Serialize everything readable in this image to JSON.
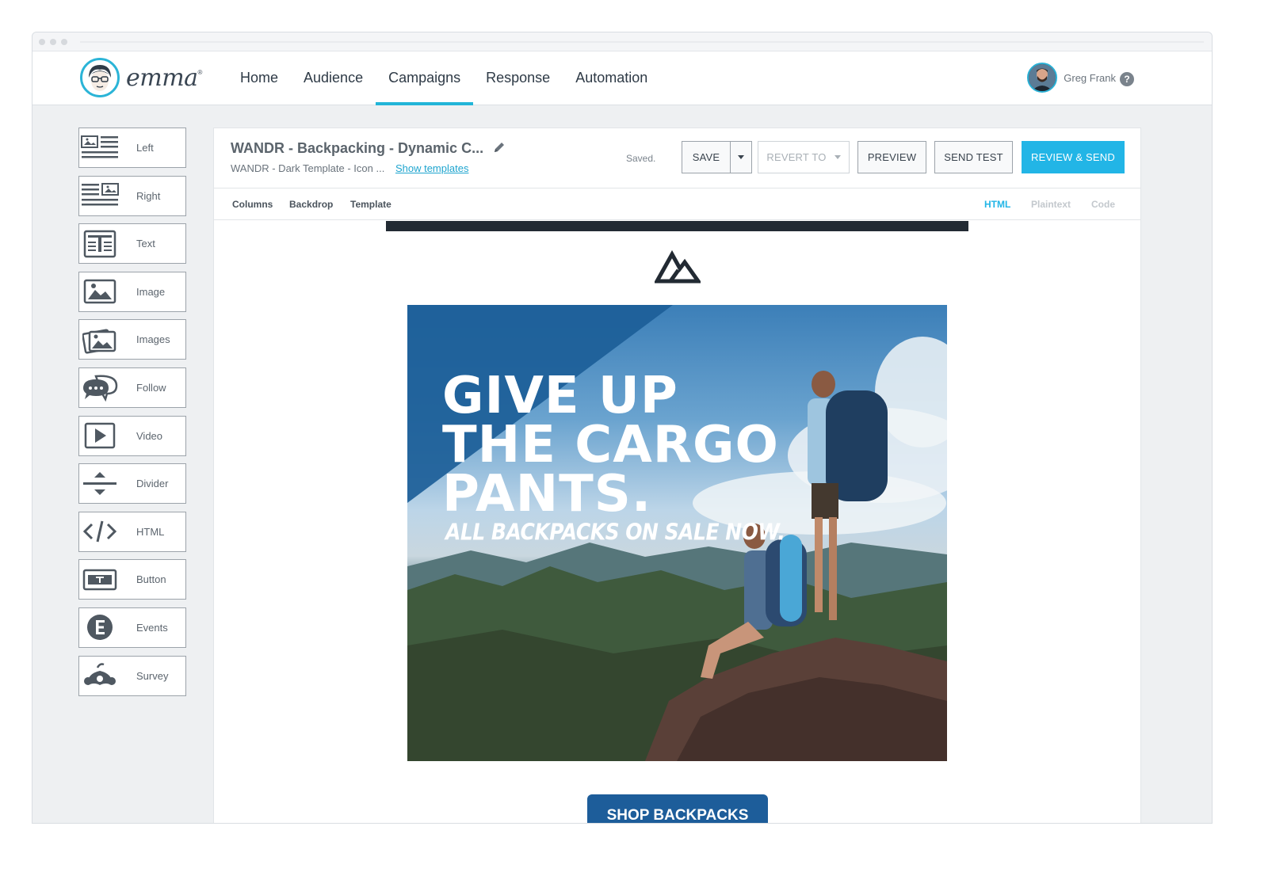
{
  "nav": {
    "brand": "emma",
    "brand_mark": "®",
    "items": [
      {
        "label": "Home",
        "active": false
      },
      {
        "label": "Audience",
        "active": false
      },
      {
        "label": "Campaigns",
        "active": true
      },
      {
        "label": "Response",
        "active": false
      },
      {
        "label": "Automation",
        "active": false
      }
    ],
    "user_name": "Greg Frank",
    "help_icon": "?"
  },
  "palette": {
    "blocks": [
      {
        "label": "Left",
        "icon": "layout-left-icon"
      },
      {
        "label": "Right",
        "icon": "layout-right-icon"
      },
      {
        "label": "Text",
        "icon": "text-block-icon"
      },
      {
        "label": "Image",
        "icon": "image-icon"
      },
      {
        "label": "Images",
        "icon": "images-icon"
      },
      {
        "label": "Follow",
        "icon": "chat-bubbles-icon"
      },
      {
        "label": "Video",
        "icon": "play-icon"
      },
      {
        "label": "Divider",
        "icon": "divider-icon"
      },
      {
        "label": "HTML",
        "icon": "code-icon"
      },
      {
        "label": "Button",
        "icon": "button-icon"
      },
      {
        "label": "Events",
        "icon": "events-icon"
      },
      {
        "label": "Survey",
        "icon": "survey-icon"
      }
    ]
  },
  "editor": {
    "title": "WANDR - Backpacking - Dynamic C...",
    "subtitle": "WANDR - Dark Template - Icon ...",
    "show_templates": "Show templates",
    "status": "Saved.",
    "buttons": {
      "save": "SAVE",
      "revert": "REVERT TO",
      "preview": "PREVIEW",
      "send_test": "SEND TEST",
      "review_send": "REVIEW & SEND"
    },
    "tabs_left": [
      "Columns",
      "Backdrop",
      "Template"
    ],
    "tabs_right": [
      {
        "label": "HTML",
        "active": true
      },
      {
        "label": "Plaintext",
        "active": false
      },
      {
        "label": "Code",
        "active": false
      }
    ]
  },
  "email": {
    "headline": [
      "GIVE UP",
      "THE CARGO",
      "PANTS."
    ],
    "subhead": "ALL BACKPACKS ON SALE NOW.",
    "cta": "SHOP BACKPACKS"
  },
  "colors": {
    "accent": "#22b5e6",
    "nav_underline": "#22b5d8",
    "cta": "#1d5d9a",
    "email_bar": "#222a33"
  }
}
